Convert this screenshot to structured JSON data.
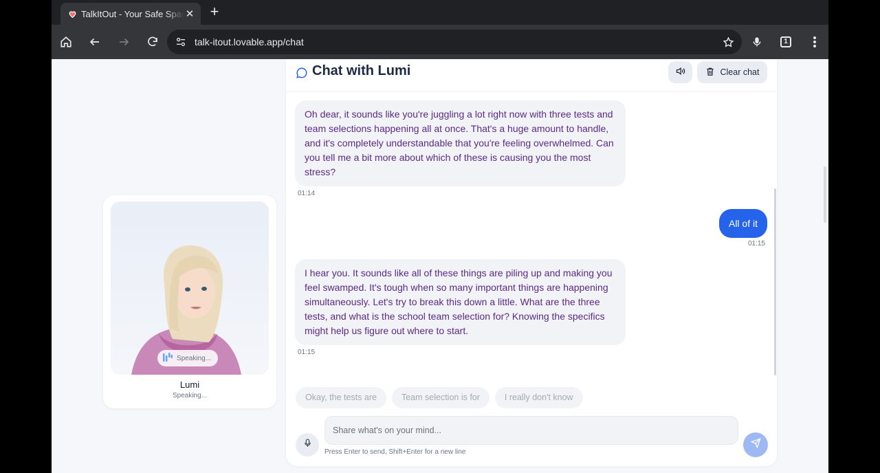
{
  "browser": {
    "tab_title": "TalkItOut - Your Safe Space to",
    "url": "talk-itout.lovable.app/chat",
    "tab_count": "1"
  },
  "chat": {
    "title": "Chat with Lumi",
    "clear_label": "Clear chat",
    "messages": [
      {
        "role": "assistant",
        "text": "Oh dear, it sounds like you're juggling a lot right now with three tests and team selections happening all at once. That's a huge amount to handle, and it's completely understandable that you're feeling overwhelmed. Can you tell me a bit more about which of these is causing you the most stress?",
        "time": "01:14"
      },
      {
        "role": "user",
        "text": "All of it",
        "time": "01:15"
      },
      {
        "role": "assistant",
        "text": "I hear you. It sounds like all of these things are piling up and making you feel swamped. It's tough when so many important things are happening simultaneously. Let's try to break this down a little. What are the three tests, and what is the school team selection for? Knowing the specifics might help us figure out where to start.",
        "time": "01:15"
      }
    ],
    "suggestions": [
      "Okay, the tests are",
      "Team selection is for",
      "I really don't know"
    ],
    "input_placeholder": "Share what's on your mind...",
    "hint": "Press Enter to send, Shift+Enter for a new line"
  },
  "avatar": {
    "name": "Lumi",
    "status": "Speaking...",
    "pill_label": "Speaking..."
  },
  "colors": {
    "accent": "#2563eb",
    "bot_text": "#5b2a86",
    "send_disabled": "#9db8f2"
  }
}
